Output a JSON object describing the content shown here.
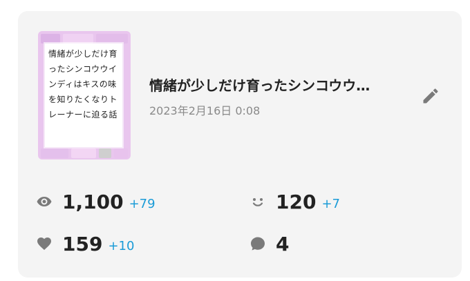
{
  "work": {
    "thumbnail_text": "情緒が少しだけ育ったシンコウウインディはキスの味を知りたくなりトレーナーに迫る話",
    "title": "情緒が少しだけ育ったシンコウウ…",
    "date": "2023年2月16日 0:08"
  },
  "stats": {
    "views": {
      "icon": "eye-icon",
      "value": "1,100",
      "delta": "+79"
    },
    "reactions": {
      "icon": "smile-icon",
      "value": "120",
      "delta": "+7"
    },
    "likes": {
      "icon": "heart-icon",
      "value": "159",
      "delta": "+10"
    },
    "comments": {
      "icon": "comment-icon",
      "value": "4"
    }
  },
  "colors": {
    "delta": "#1a9bd7",
    "icon": "#7a7a7a",
    "card": "#f4f4f4"
  }
}
